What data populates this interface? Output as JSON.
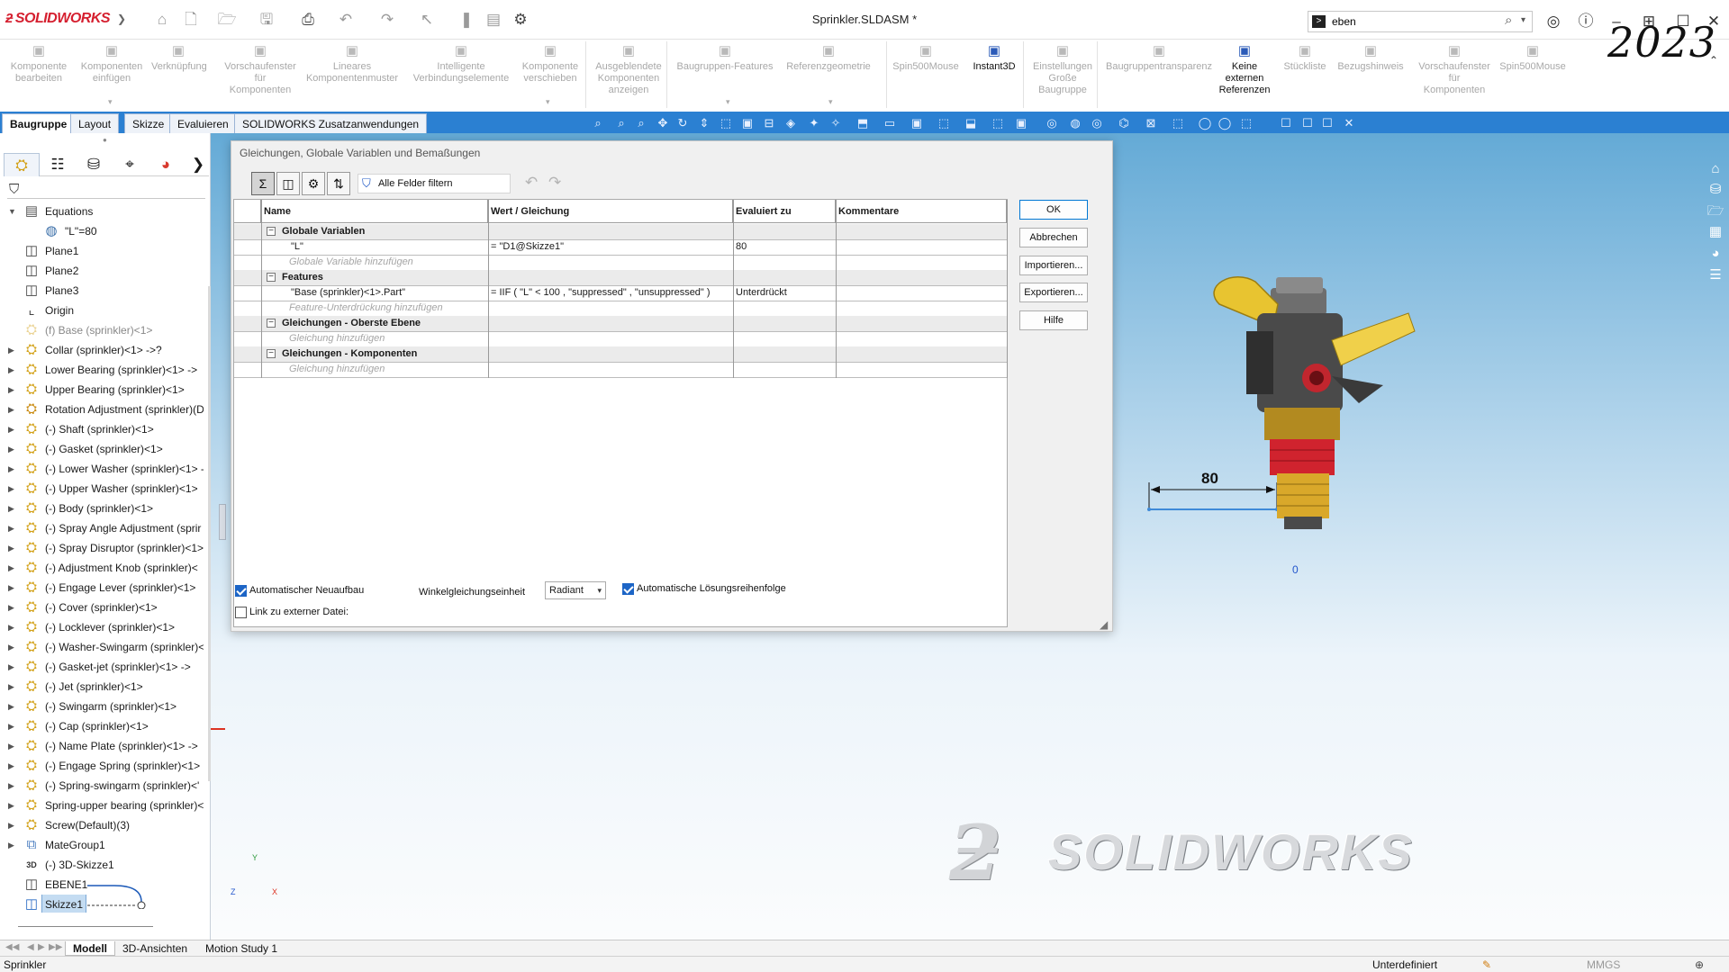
{
  "window": {
    "app_name": "SOLIDWORKS",
    "title": "Sprinkler.SLDASM *",
    "year": "2023"
  },
  "search": {
    "value": "eben"
  },
  "ribbon": {
    "items": [
      {
        "label": "Komponente\nbearbeiten",
        "icon": "edit-component-icon",
        "state": "disabled"
      },
      {
        "label": "Komponenten\neinfügen",
        "icon": "insert-components-icon",
        "state": "disabled"
      },
      {
        "label": "Verknüpfung",
        "icon": "mate-icon",
        "state": "disabled"
      },
      {
        "label": "Vorschaufenster\nfür\nKomponenten",
        "icon": "preview-window-icon",
        "state": "disabled"
      },
      {
        "label": "Lineares\nKomponentenmuster",
        "icon": "linear-pattern-icon",
        "state": "disabled"
      },
      {
        "label": "Intelligente\nVerbindungselemente",
        "icon": "smart-fasteners-icon",
        "state": "disabled"
      },
      {
        "label": "Komponente\nverschieben",
        "icon": "move-component-icon",
        "state": "disabled"
      },
      {
        "label": "Ausgeblendete\nKomponenten\nanzeigen",
        "icon": "show-hidden-icon",
        "state": "disabled"
      },
      {
        "label": "Baugruppen-Features",
        "icon": "assembly-features-icon",
        "state": "disabled"
      },
      {
        "label": "Referenzgeometrie",
        "icon": "reference-geometry-icon",
        "state": "disabled"
      },
      {
        "label": "Spin500Mouse",
        "icon": "spin-mouse-icon",
        "state": "disabled"
      },
      {
        "label": "Instant3D",
        "icon": "instant3d-icon",
        "state": "active"
      },
      {
        "label": "Einstellungen\nGroße\nBaugruppe",
        "icon": "large-assembly-icon",
        "state": "disabled"
      },
      {
        "label": "Baugruppentransparenz",
        "icon": "assembly-transparency-icon",
        "state": "disabled"
      },
      {
        "label": "Keine\nexternen\nReferenzen",
        "icon": "no-external-references-icon",
        "state": "active"
      },
      {
        "label": "Stückliste",
        "icon": "bill-of-materials-icon",
        "state": "disabled"
      },
      {
        "label": "Bezugshinweis",
        "icon": "balloon-icon",
        "state": "disabled"
      },
      {
        "label": "Vorschaufenster\nfür\nKomponenten",
        "icon": "preview-window-icon",
        "state": "disabled"
      },
      {
        "label": "Spin500Mouse",
        "icon": "spin-mouse-icon",
        "state": "disabled"
      }
    ]
  },
  "command_tabs": [
    "Baugruppe",
    "Layout",
    "Skizze",
    "Evaluieren",
    "SOLIDWORKS Zusatzanwendungen"
  ],
  "tree": [
    {
      "label": "Equations",
      "icon": "equations-folder-icon",
      "expand": true,
      "state": "normal"
    },
    {
      "label": "\"L\"=80",
      "icon": "global-variable-icon",
      "expand": false,
      "state": "child"
    },
    {
      "label": "Plane1",
      "icon": "plane-icon",
      "expand": false,
      "state": "normal"
    },
    {
      "label": "Plane2",
      "icon": "plane-icon",
      "expand": false,
      "state": "normal"
    },
    {
      "label": "Plane3",
      "icon": "plane-icon",
      "expand": false,
      "state": "normal"
    },
    {
      "label": "Origin",
      "icon": "origin-icon",
      "expand": false,
      "state": "normal"
    },
    {
      "label": "(f) Base (sprinkler)<1>",
      "icon": "part-icon",
      "expand": false,
      "state": "suppressed"
    },
    {
      "label": "Collar (sprinkler)<1> ->?",
      "icon": "part-icon",
      "expand": true,
      "state": "normal"
    },
    {
      "label": "Lower Bearing (sprinkler)<1> ->",
      "icon": "part-icon",
      "expand": true,
      "state": "normal"
    },
    {
      "label": "Upper Bearing (sprinkler)<1>",
      "icon": "part-icon",
      "expand": true,
      "state": "normal"
    },
    {
      "label": "Rotation Adjustment (sprinkler)(D",
      "icon": "subassembly-icon",
      "expand": true,
      "state": "normal"
    },
    {
      "label": "(-) Shaft (sprinkler)<1>",
      "icon": "part-icon",
      "expand": true,
      "state": "normal"
    },
    {
      "label": "(-) Gasket (sprinkler)<1>",
      "icon": "part-icon",
      "expand": true,
      "state": "normal"
    },
    {
      "label": "(-) Lower Washer (sprinkler)<1> -",
      "icon": "part-icon",
      "expand": true,
      "state": "normal"
    },
    {
      "label": "(-) Upper Washer (sprinkler)<1>",
      "icon": "part-icon",
      "expand": true,
      "state": "normal"
    },
    {
      "label": "(-) Body (sprinkler)<1>",
      "icon": "part-icon",
      "expand": true,
      "state": "normal"
    },
    {
      "label": "(-) Spray Angle Adjustment (sprir",
      "icon": "part-icon",
      "expand": true,
      "state": "normal"
    },
    {
      "label": "(-) Spray Disruptor (sprinkler)<1>",
      "icon": "part-icon",
      "expand": true,
      "state": "normal"
    },
    {
      "label": "(-) Adjustment Knob (sprinkler)<",
      "icon": "part-icon",
      "expand": true,
      "state": "normal"
    },
    {
      "label": "(-) Engage Lever (sprinkler)<1>",
      "icon": "part-icon",
      "expand": true,
      "state": "normal"
    },
    {
      "label": "(-) Cover (sprinkler)<1>",
      "icon": "part-icon",
      "expand": true,
      "state": "normal"
    },
    {
      "label": "(-) Locklever (sprinkler)<1>",
      "icon": "part-icon",
      "expand": true,
      "state": "normal"
    },
    {
      "label": "(-) Washer-Swingarm (sprinkler)<",
      "icon": "part-icon",
      "expand": true,
      "state": "normal"
    },
    {
      "label": "(-) Gasket-jet (sprinkler)<1> ->",
      "icon": "part-icon",
      "expand": true,
      "state": "normal"
    },
    {
      "label": "(-) Jet (sprinkler)<1>",
      "icon": "part-icon",
      "expand": true,
      "state": "normal"
    },
    {
      "label": "(-) Swingarm (sprinkler)<1>",
      "icon": "part-icon",
      "expand": true,
      "state": "normal"
    },
    {
      "label": "(-) Cap (sprinkler)<1>",
      "icon": "part-icon",
      "expand": true,
      "state": "normal"
    },
    {
      "label": "(-) Name Plate (sprinkler)<1> ->",
      "icon": "part-icon",
      "expand": true,
      "state": "normal"
    },
    {
      "label": "(-) Engage Spring (sprinkler)<1>",
      "icon": "part-icon",
      "expand": true,
      "state": "normal"
    },
    {
      "label": "(-) Spring-swingarm (sprinkler)<'",
      "icon": "part-icon",
      "expand": true,
      "state": "normal"
    },
    {
      "label": "Spring-upper bearing (sprinkler)<",
      "icon": "part-icon",
      "expand": true,
      "state": "normal"
    },
    {
      "label": "Screw(Default)(3)",
      "icon": "pattern-icon",
      "expand": true,
      "state": "normal"
    },
    {
      "label": "MateGroup1",
      "icon": "mates-icon",
      "expand": true,
      "state": "normal"
    },
    {
      "label": "(-) 3D-Skizze1",
      "icon": "3d-sketch-icon",
      "expand": false,
      "state": "normal"
    },
    {
      "label": "EBENE1",
      "icon": "plane-icon",
      "expand": false,
      "state": "normal"
    },
    {
      "label": "Skizze1",
      "icon": "sketch-icon",
      "expand": false,
      "state": "selected"
    }
  ],
  "dialog": {
    "title": "Gleichungen, Globale Variablen und Bemaßungen",
    "filter_label": "Alle Felder filtern",
    "columns": [
      "Name",
      "Wert / Gleichung",
      "Evaluiert zu",
      "Kommentare"
    ],
    "rows": [
      {
        "type": "section",
        "name": "Globale Variablen"
      },
      {
        "type": "data",
        "name": "\"L\"",
        "value": "= \"D1@Skizze1\"",
        "eval": "80",
        "comment": ""
      },
      {
        "type": "hint",
        "name": "Globale Variable hinzufügen"
      },
      {
        "type": "section",
        "name": "Features"
      },
      {
        "type": "data",
        "name": "\"Base (sprinkler)<1>.Part\"",
        "value": "= IIF ( \"L\" < 100 , \"suppressed\" , \"unsuppressed\" )",
        "eval": "Unterdrückt",
        "comment": ""
      },
      {
        "type": "hint",
        "name": "Feature-Unterdrückung hinzufügen"
      },
      {
        "type": "section",
        "name": "Gleichungen - Oberste Ebene"
      },
      {
        "type": "hint",
        "name": "Gleichung hinzufügen"
      },
      {
        "type": "section",
        "name": "Gleichungen - Komponenten"
      },
      {
        "type": "hint",
        "name": "Gleichung hinzufügen"
      }
    ],
    "buttons": {
      "ok": "OK",
      "cancel": "Abbrechen",
      "import": "Importieren...",
      "export": "Exportieren...",
      "help": "Hilfe"
    },
    "options": {
      "auto_rebuild": "Automatischer Neuaufbau",
      "auto_rebuild_checked": true,
      "angle_unit_label": "Winkelgleichungseinheit",
      "angle_unit_value": "Radiant",
      "auto_solve": "Automatische Lösungsreihenfolge",
      "auto_solve_checked": true,
      "link_external": "Link zu externer Datei:",
      "link_external_checked": false
    }
  },
  "viewport": {
    "dimension_value": "80",
    "origin_label": "0",
    "watermark": "SOLIDWORKS",
    "triad_y": "Y",
    "triad_x": "X",
    "triad_z": "Z"
  },
  "bottom_tabs": [
    "Modell",
    "3D-Ansichten",
    "Motion Study 1"
  ],
  "status": {
    "left": "Sprinkler",
    "state": "Unterdefiniert",
    "units": "MMGS"
  },
  "colors": {
    "accent": "#2b80d2",
    "logo_red": "#d51f2f",
    "selection": "#c4dcf2",
    "checkbox": "#1d65c6"
  }
}
